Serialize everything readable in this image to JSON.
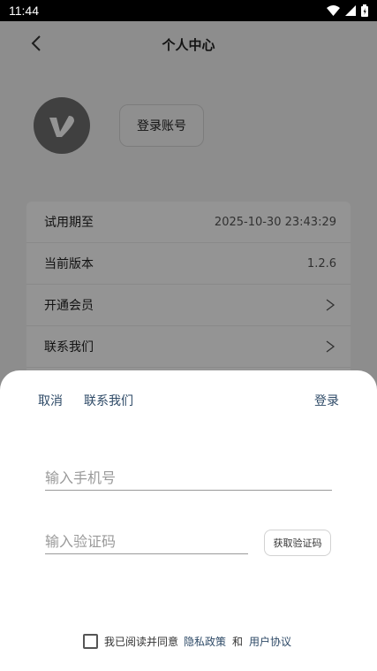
{
  "status_bar": {
    "time": "11:44"
  },
  "header": {
    "title": "个人中心"
  },
  "profile": {
    "login_button": "登录账号"
  },
  "info_rows": [
    {
      "label": "试用期至",
      "value": "2025-10-30 23:43:29"
    },
    {
      "label": "当前版本",
      "value": "1.2.6"
    },
    {
      "label": "开通会员",
      "value": ""
    },
    {
      "label": "联系我们",
      "value": ""
    }
  ],
  "sheet": {
    "cancel": "取消",
    "contact": "联系我们",
    "login": "登录",
    "phone_placeholder": "输入手机号",
    "code_placeholder": "输入验证码",
    "get_code": "获取验证码",
    "agreement_prefix": "我已阅读并同意",
    "privacy_policy": "隐私政策",
    "and": "和",
    "user_agreement": "用户协议"
  },
  "colors": {
    "link": "#2e4a67",
    "overlay": "rgba(0,0,0,0.42)"
  },
  "icons": [
    "back-arrow-icon",
    "app-logo-icon",
    "chevron-right-icon",
    "wifi-icon",
    "signal-icon",
    "battery-icon"
  ]
}
